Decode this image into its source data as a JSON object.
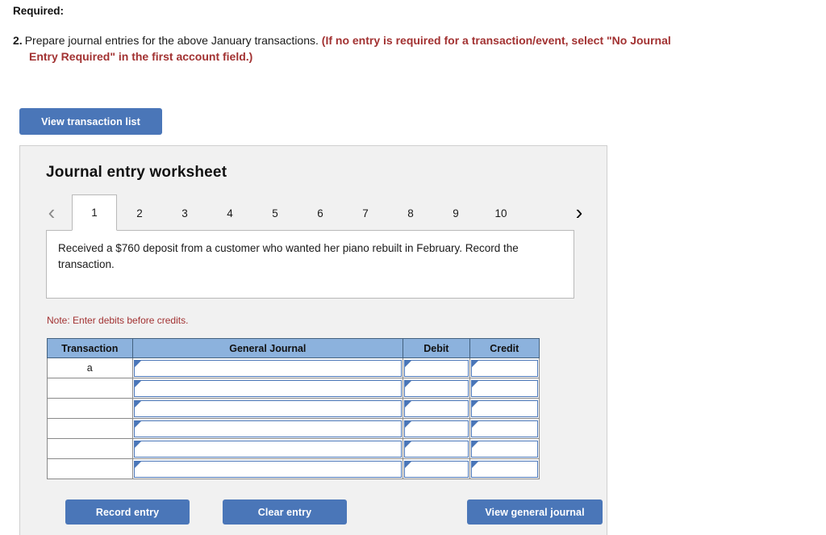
{
  "instructions": {
    "required_label": "Required:",
    "item_number": "2.",
    "item_text": "Prepare journal entries for the above January transactions.",
    "item_note_red_line1": "(If no entry is required for a transaction/event, select \"No Journal",
    "item_note_red_line2": "Entry Required\" in the first account field.)"
  },
  "toolbar": {
    "view_transaction_list_label": "View transaction list"
  },
  "worksheet": {
    "title": "Journal entry worksheet",
    "prev_icon": "chevron-left-icon",
    "next_icon": "chevron-right-icon",
    "prev_glyph": "‹",
    "next_glyph": "›",
    "tabs": [
      {
        "label": "1",
        "active": true
      },
      {
        "label": "2",
        "active": false
      },
      {
        "label": "3",
        "active": false
      },
      {
        "label": "4",
        "active": false
      },
      {
        "label": "5",
        "active": false
      },
      {
        "label": "6",
        "active": false
      },
      {
        "label": "7",
        "active": false
      },
      {
        "label": "8",
        "active": false
      },
      {
        "label": "9",
        "active": false
      },
      {
        "label": "10",
        "active": false
      }
    ],
    "transaction_text": "Received a $760 deposit from a customer who wanted her piano rebuilt in February. Record the transaction.",
    "note": "Note: Enter debits before credits.",
    "table": {
      "headers": [
        "Transaction",
        "General Journal",
        "Debit",
        "Credit"
      ],
      "rows": [
        {
          "transaction": "a",
          "general_journal": "",
          "debit": "",
          "credit": ""
        },
        {
          "transaction": "",
          "general_journal": "",
          "debit": "",
          "credit": ""
        },
        {
          "transaction": "",
          "general_journal": "",
          "debit": "",
          "credit": ""
        },
        {
          "transaction": "",
          "general_journal": "",
          "debit": "",
          "credit": ""
        },
        {
          "transaction": "",
          "general_journal": "",
          "debit": "",
          "credit": ""
        },
        {
          "transaction": "",
          "general_journal": "",
          "debit": "",
          "credit": ""
        }
      ]
    },
    "footer": {
      "record_entry_label": "Record entry",
      "clear_entry_label": "Clear entry",
      "view_general_journal_label": "View general journal"
    }
  },
  "colors": {
    "button_blue": "#4a76b8",
    "table_header_blue": "#8cb2dd",
    "alert_red": "#a23232",
    "panel_gray": "#f1f1f1",
    "field_border_blue": "#4a76b8"
  }
}
